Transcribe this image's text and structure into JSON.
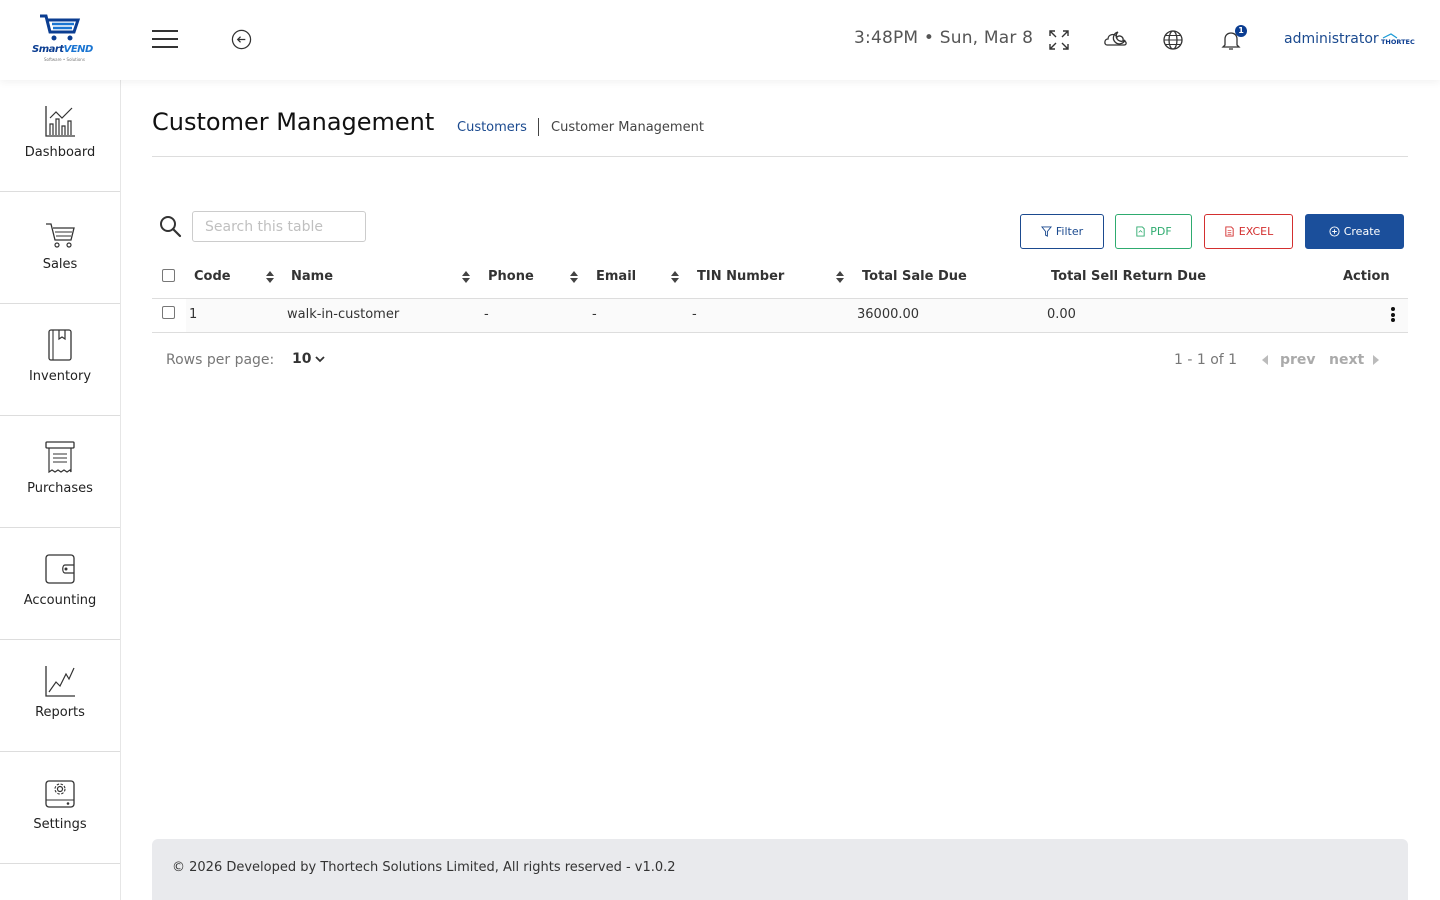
{
  "header": {
    "logo_brand": "Smart",
    "logo_brand_accent": "VEND",
    "logo_tagline": "Software • Solutions",
    "clock": "3:48PM • Sun, Mar 8",
    "notification_count": "1",
    "user_name": "administrator",
    "partner_logo": "THORTECH",
    "icons": [
      "menu-icon",
      "back-icon",
      "fullscreen-icon",
      "theme-icon",
      "globe-icon",
      "bell-icon"
    ]
  },
  "sidebar": {
    "items": [
      {
        "label": "Dashboard",
        "icon": "bar-chart-icon"
      },
      {
        "label": "Sales",
        "icon": "cart-icon"
      },
      {
        "label": "Inventory",
        "icon": "book-icon"
      },
      {
        "label": "Purchases",
        "icon": "receipt-icon"
      },
      {
        "label": "Accounting",
        "icon": "wallet-icon"
      },
      {
        "label": "Reports",
        "icon": "line-chart-icon"
      },
      {
        "label": "Settings",
        "icon": "gear-drive-icon"
      }
    ]
  },
  "page": {
    "title": "Customer Management",
    "breadcrumb_link": "Customers",
    "breadcrumb_current": "Customer Management"
  },
  "toolbar": {
    "search_placeholder": "Search this table",
    "filter_label": "Filter",
    "pdf_label": "PDF",
    "excel_label": "EXCEL",
    "create_label": "Create"
  },
  "table": {
    "columns": [
      "Code",
      "Name",
      "Phone",
      "Email",
      "TIN Number",
      "Total Sale Due",
      "Total Sell Return Due",
      "Action"
    ],
    "rows": [
      {
        "code": "1",
        "name": "walk-in-customer",
        "phone": "-",
        "email": "-",
        "tin": "-",
        "total_sale_due": "36000.00",
        "total_sell_return_due": "0.00"
      }
    ]
  },
  "pagination": {
    "rows_per_page_label": "Rows per page:",
    "rows_per_page": "10",
    "range": "1 - 1 of 1",
    "prev": "prev",
    "next": "next"
  },
  "footer": {
    "text": "© 2026 Developed by Thortech Solutions Limited, All rights reserved - v1.0.2"
  },
  "colors": {
    "primary": "#1b4f9b",
    "link": "#1b4a8f",
    "pdf": "#2eab6f",
    "excel": "#d32f2f",
    "footer_bg": "#e9eaed"
  }
}
